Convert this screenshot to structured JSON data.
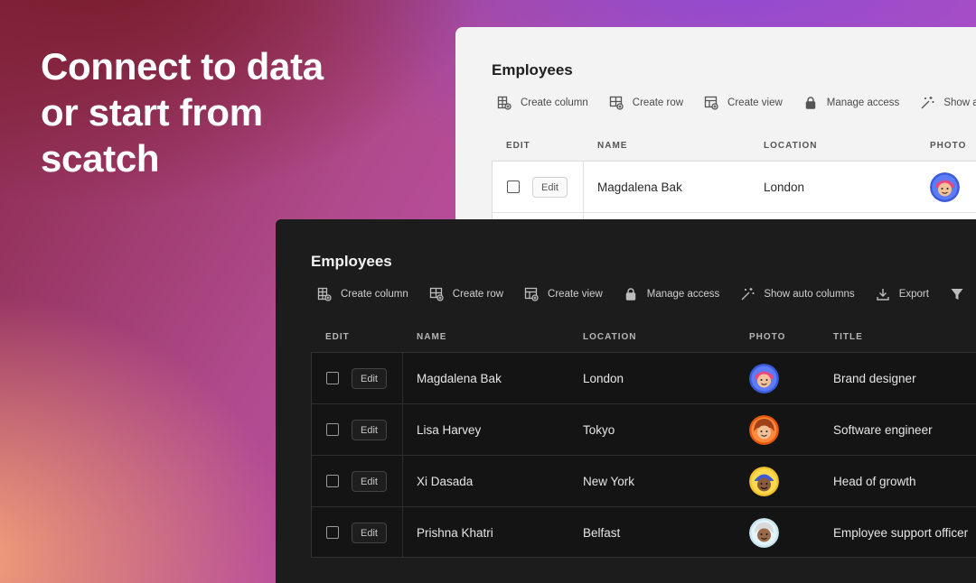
{
  "headline": "Connect to data\nor start from\nscatch",
  "light_card": {
    "title": "Employees",
    "toolbar": [
      {
        "label": "Create column",
        "icon": "create-column-icon"
      },
      {
        "label": "Create row",
        "icon": "create-row-icon"
      },
      {
        "label": "Create view",
        "icon": "create-view-icon"
      },
      {
        "label": "Manage access",
        "icon": "lock-icon"
      },
      {
        "label": "Show a",
        "icon": "magic-wand-icon"
      }
    ],
    "headers": {
      "edit": "EDIT",
      "name": "NAME",
      "location": "LOCATION",
      "photo": "PHOTO"
    },
    "rows": [
      {
        "edit": "Edit",
        "name": "Magdalena Bak",
        "location": "London"
      }
    ]
  },
  "dark_card": {
    "title": "Employees",
    "toolbar": [
      {
        "label": "Create column",
        "icon": "create-column-icon"
      },
      {
        "label": "Create row",
        "icon": "create-row-icon"
      },
      {
        "label": "Create view",
        "icon": "create-view-icon"
      },
      {
        "label": "Manage access",
        "icon": "lock-icon"
      },
      {
        "label": "Show auto columns",
        "icon": "magic-wand-icon"
      },
      {
        "label": "Export",
        "icon": "download-icon"
      },
      {
        "label": "",
        "icon": "filter-icon"
      }
    ],
    "headers": {
      "edit": "EDIT",
      "name": "NAME",
      "location": "LOCATION",
      "photo": "PHOTO",
      "title": "TITLE"
    },
    "rows": [
      {
        "edit": "Edit",
        "name": "Magdalena Bak",
        "location": "London",
        "title": "Brand designer",
        "avatar_bg": "#3b5bdb"
      },
      {
        "edit": "Edit",
        "name": "Lisa Harvey",
        "location": "Tokyo",
        "title": "Software engineer",
        "avatar_bg": "#e8590c"
      },
      {
        "edit": "Edit",
        "name": "Xi Dasada",
        "location": "New York",
        "title": "Head of growth",
        "avatar_bg": "#f2c12e"
      },
      {
        "edit": "Edit",
        "name": "Prishna Khatri",
        "location": "Belfast",
        "title": "Employee support officer",
        "avatar_bg": "#c9e6f0"
      }
    ]
  }
}
